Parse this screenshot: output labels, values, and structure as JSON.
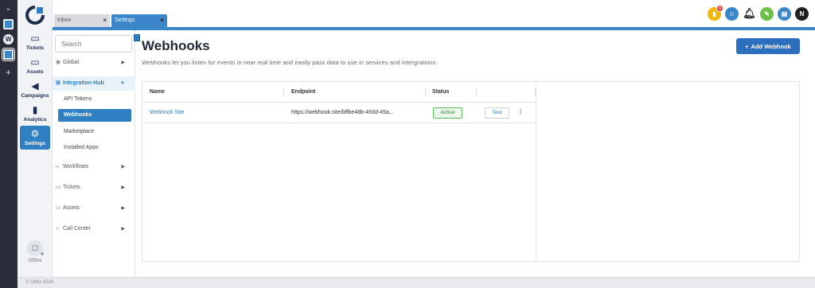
{
  "app": {
    "nav": [
      {
        "label": "Tickets",
        "icon": "monitor-icon"
      },
      {
        "label": "Assets",
        "icon": "desktop-icon"
      },
      {
        "label": "Campaigns",
        "icon": "megaphone-icon"
      },
      {
        "label": "Analytics",
        "icon": "bar-chart-icon"
      },
      {
        "label": "Settings",
        "icon": "gear-icon",
        "active": true
      }
    ],
    "status_label": "Offline",
    "footer": "© Onfix 2026"
  },
  "tabs": [
    {
      "label": "Inbox",
      "active": false
    },
    {
      "label": "Settings",
      "active": true
    }
  ],
  "topbar": {
    "notification_badge": "0",
    "user_initial": "N"
  },
  "sidebar": {
    "search_placeholder": "Search",
    "items": [
      {
        "label": "Global",
        "icon": "globe-icon"
      },
      {
        "label": "Integration Hub",
        "icon": "grid-icon",
        "expanded": true
      },
      {
        "label": "Workflows",
        "icon": "workflow-icon"
      },
      {
        "label": "Tickets",
        "icon": "monitor-icon"
      },
      {
        "label": "Assets",
        "icon": "desktop-icon"
      },
      {
        "label": "Call Center",
        "icon": "headset-icon"
      }
    ],
    "subitems": [
      {
        "label": "API Tokens"
      },
      {
        "label": "Webhooks",
        "active": true
      },
      {
        "label": "Marketplace"
      },
      {
        "label": "Installed Apps"
      }
    ]
  },
  "page": {
    "title": "Webhooks",
    "description": "Webhooks let you listen for events in near real time and easily pass data to use in services and intergrations.",
    "add_button": "Add Webhook"
  },
  "table": {
    "columns": [
      "Name",
      "Endpoint",
      "Status"
    ],
    "rows": [
      {
        "name": "Webhook Site",
        "endpoint": "https://webhook.site/bffbe48b-493d-45a...",
        "status": "Active",
        "action": "Test"
      }
    ]
  },
  "colors": {
    "accent": "#2f7fc3",
    "tab_blue": "#3b86c9",
    "rail": "#2b2d3a",
    "status_active": "#2e7d32"
  }
}
